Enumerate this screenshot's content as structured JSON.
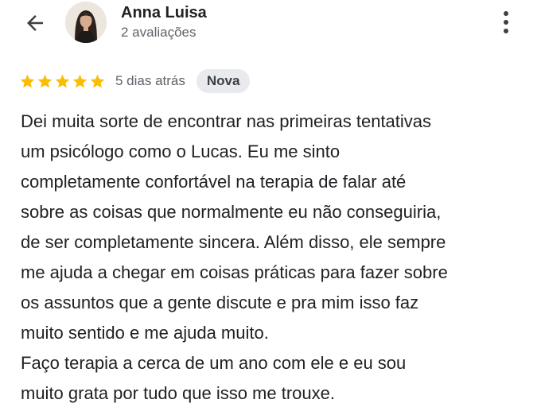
{
  "header": {
    "back_icon": "arrow-back-icon",
    "avatar_icon": "user-avatar-photo",
    "user_name": "Anna Luisa",
    "review_count": "2 avaliações",
    "more_icon": "more-vert-icon"
  },
  "review": {
    "rating": 5,
    "rating_max": 5,
    "star_color": "#fbbc04",
    "time_ago": "5 dias atrás",
    "badge": "Nova",
    "lines": [
      "Dei muita sorte de encontrar nas primeiras tentativas",
      "um psicólogo como o Lucas. Eu me sinto",
      "completamente confortável na terapia de falar até",
      "sobre as coisas que normalmente eu não conseguiria,",
      "de ser completamente sincera. Além disso, ele sempre",
      "me ajuda a chegar em coisas práticas para fazer sobre",
      "os assuntos que a gente discute e pra mim isso faz",
      "muito sentido e me ajuda muito.",
      "Faço terapia a cerca de um ano com ele e eu sou",
      "muito grata por tudo que isso me trouxe."
    ]
  }
}
